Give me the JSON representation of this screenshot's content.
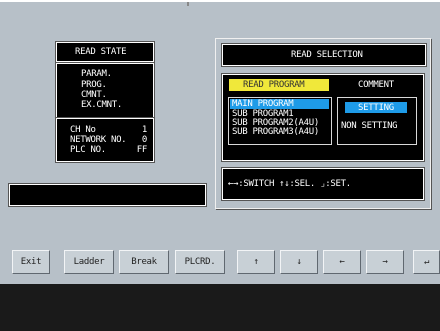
{
  "read_state": {
    "title": "READ STATE",
    "items": [
      "PARAM.",
      "PROG.",
      "CMNT.",
      "EX.CMNT."
    ],
    "info": [
      {
        "label": "CH No",
        "value": "1"
      },
      {
        "label": "NETWORK NO.",
        "value": "0"
      },
      {
        "label": "PLC NO.",
        "value": "FF"
      }
    ]
  },
  "read_selection": {
    "title": "READ SELECTION",
    "program_header": "READ PROGRAM",
    "comment_header": "COMMENT",
    "programs": [
      "MAIN PROGRAM",
      "SUB PROGRAM1",
      "SUB PROGRAM2(A4U)",
      "SUB PROGRAM3(A4U)"
    ],
    "selected_program": "MAIN PROGRAM",
    "comment_options": [
      "SETTING",
      "NON SETTING"
    ],
    "selected_comment": "SETTING",
    "help": "←→:SWITCH  ↑↓:SEL.  ⌟:SET."
  },
  "message": "",
  "buttons": [
    "Exit",
    "Ladder",
    "Break",
    "PLCRD.",
    "↑",
    "↓",
    "←",
    "→",
    "↵"
  ],
  "colors": {
    "panel_bg": "#b7c0c8",
    "screen_bg": "#000000",
    "selection_highlight": "#1e9be8",
    "header_yellow": "#f0e83a",
    "button_face": "#c8d0d6"
  }
}
